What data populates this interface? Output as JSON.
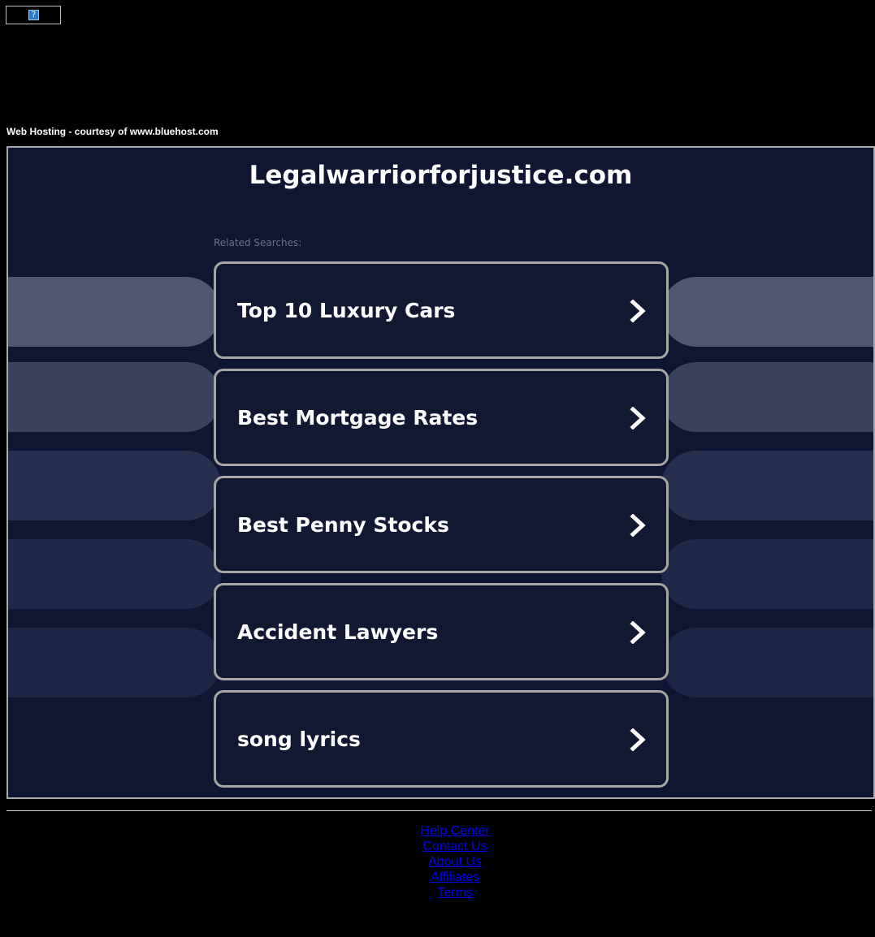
{
  "banner": {
    "icon": "question-mark-icon",
    "glyph": "?"
  },
  "hosting_text": "Web Hosting - courtesy of www.bluehost.com",
  "site_title": "Legalwarriorforjustice.com",
  "related_label": "Related Searches:",
  "searches": [
    {
      "label": "Top 10 Luxury Cars"
    },
    {
      "label": "Best Mortgage Rates"
    },
    {
      "label": "Best Penny Stocks"
    },
    {
      "label": "Accident Lawyers"
    },
    {
      "label": "song lyrics"
    }
  ],
  "footer_links": [
    "Help Center",
    "Contact Us",
    "About Us",
    "Affiliates",
    "Terms"
  ],
  "colors": {
    "page_bg": "#000000",
    "panel_bg": "#101631",
    "card_bg": "#121832",
    "card_border": "#a6a6a6",
    "link": "#0000ee",
    "side_pills": [
      "#4e5670",
      "#3a4260",
      "#272f4e",
      "#202848",
      "#1c2545"
    ]
  }
}
